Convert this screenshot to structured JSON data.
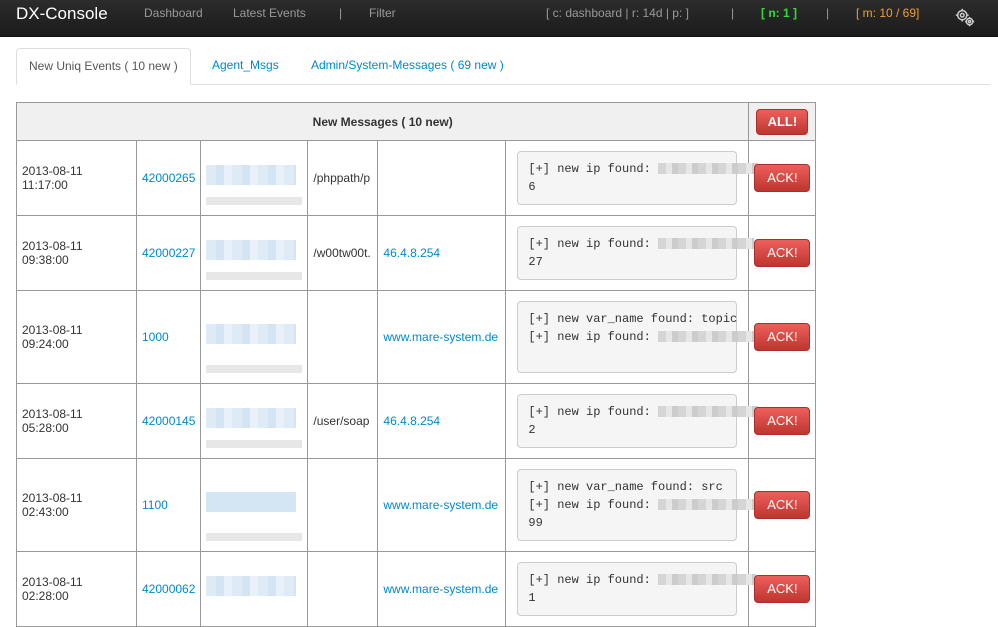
{
  "navbar": {
    "brand": "DX-Console",
    "links": [
      "Dashboard",
      "Latest Events",
      "Filter"
    ],
    "separator": "|",
    "status_text": "[ c: dashboard | r: 14d | p: ]",
    "status_n": "[ n: 1 ]",
    "status_m": "[ m: 10 / 69]",
    "colors": {
      "n": "#33dd33",
      "m": "#f0a030"
    },
    "settings_icon": "gear-icon"
  },
  "tabs": [
    {
      "label": "New Uniq Events ( 10 new )",
      "active": true
    },
    {
      "label": "Agent_Msgs",
      "active": false
    },
    {
      "label": "Admin/System-Messages ( 69 new )",
      "active": false
    }
  ],
  "table": {
    "header": "New Messages ( 10 new)",
    "all_button": "ALL!",
    "ack_label": "ACK!",
    "rows": [
      {
        "time": "2013-08-11 11:17:00",
        "id": "42000265",
        "path": "/phppath/p",
        "host": "",
        "msg_lines": [
          "[+] new ip found:"
        ],
        "msg_tail": "6"
      },
      {
        "time": "2013-08-11 09:38:00",
        "id": "42000227",
        "path": "/w00tw00t.",
        "host": "46.4.8.254",
        "msg_lines": [
          "[+] new ip found:"
        ],
        "msg_tail": "27"
      },
      {
        "time": "2013-08-11 09:24:00",
        "id": "1000",
        "path": "",
        "host": "www.mare-system.de",
        "msg_lines": [
          "[+] new var_name found: topic",
          "[+] new ip found:"
        ],
        "msg_tail": ""
      },
      {
        "time": "2013-08-11 05:28:00",
        "id": "42000145",
        "path": "/user/soap",
        "host": "46.4.8.254",
        "msg_lines": [
          "[+] new ip found:"
        ],
        "msg_tail": "2"
      },
      {
        "time": "2013-08-11 02:43:00",
        "id": "1100",
        "path": "",
        "host": "www.mare-system.de",
        "msg_lines": [
          "[+] new var_name found: src",
          "[+] new ip found:"
        ],
        "msg_tail": "99"
      },
      {
        "time": "2013-08-11 02:28:00",
        "id": "42000062",
        "path": "",
        "host": "www.mare-system.de",
        "msg_lines": [
          "[+] new ip found:"
        ],
        "msg_tail": "1"
      }
    ]
  }
}
